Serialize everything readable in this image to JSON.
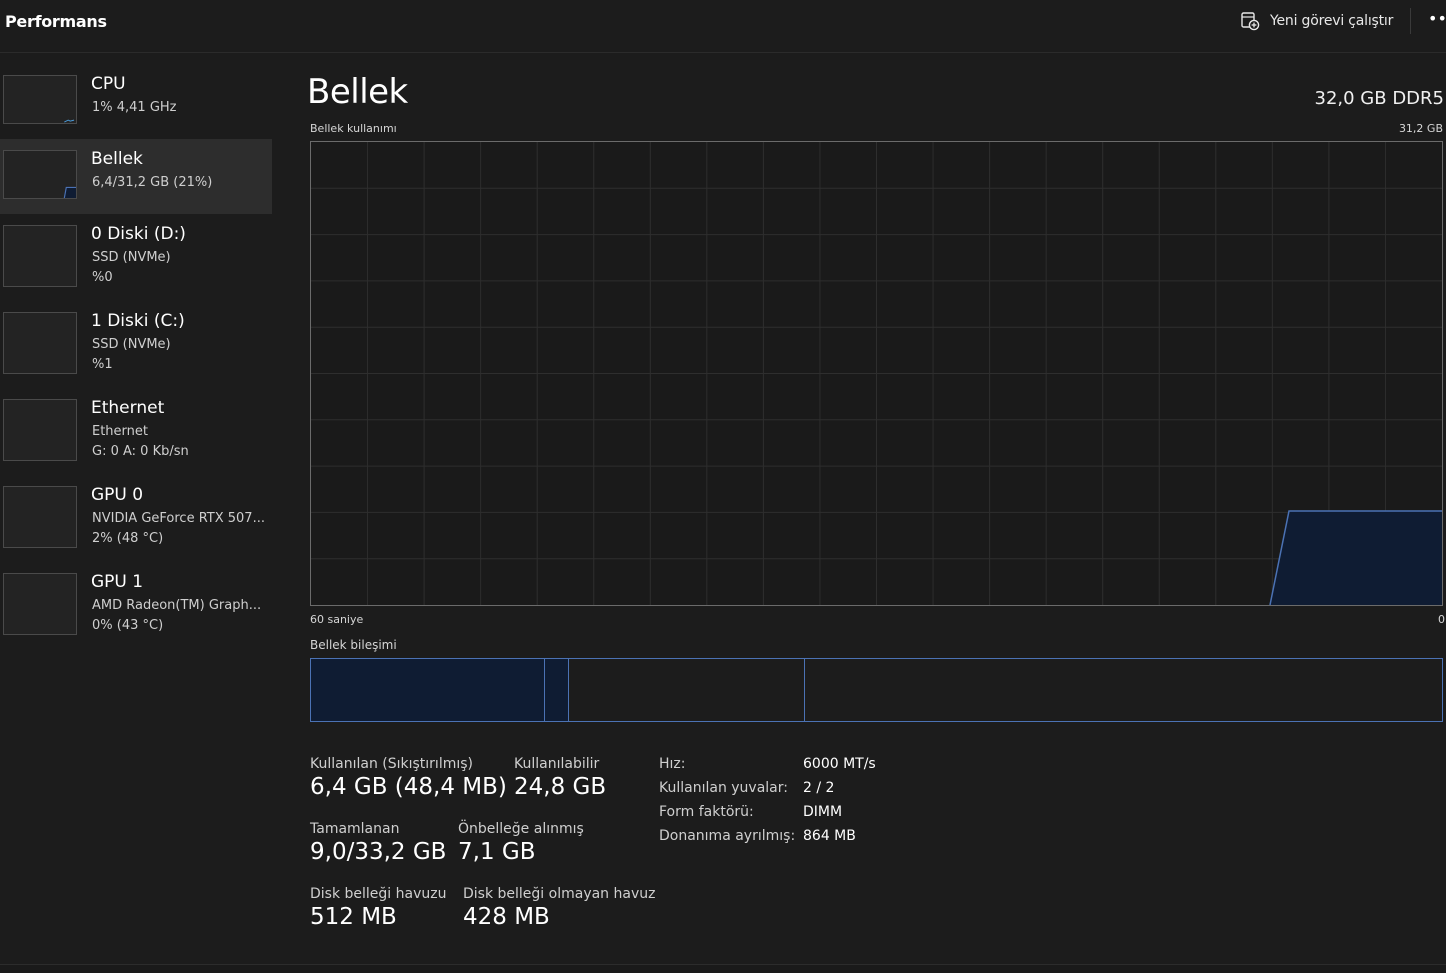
{
  "header": {
    "title": "Performans",
    "new_task_label": "Yeni görevi çalıştır",
    "more_glyph": "•••"
  },
  "sidebar": {
    "items": [
      {
        "title": "CPU",
        "line1": "1%  4,41 GHz",
        "line2": ""
      },
      {
        "title": "Bellek",
        "line1": "6,4/31,2 GB (21%)",
        "line2": ""
      },
      {
        "title": "0 Diski (D:)",
        "line1": "SSD (NVMe)",
        "line2": "%0"
      },
      {
        "title": "1 Diski (C:)",
        "line1": "SSD (NVMe)",
        "line2": "%1"
      },
      {
        "title": "Ethernet",
        "line1": "Ethernet",
        "line2": "G: 0  A: 0 Kb/sn"
      },
      {
        "title": "GPU 0",
        "line1": "NVIDIA GeForce RTX 507...",
        "line2": "2%  (48 °C)"
      },
      {
        "title": "GPU 1",
        "line1": "AMD Radeon(TM) Graph...",
        "line2": "0%  (43 °C)"
      }
    ],
    "selected_index": 1
  },
  "main": {
    "title": "Bellek",
    "memory_type": "32,0 GB DDR5",
    "usage_graph": {
      "label": "Bellek kullanımı",
      "max_label": "31,2 GB",
      "time_left_label": "60 saniye",
      "time_right_label": "0"
    },
    "composition": {
      "label": "Bellek bileşimi",
      "segments_fraction": [
        0.207,
        0.021,
        0.209,
        0.563
      ]
    },
    "stats": {
      "in_use_label": "Kullanılan (Sıkıştırılmış)",
      "in_use_value": "6,4 GB (48,4 MB)",
      "available_label": "Kullanılabilir",
      "available_value": "24,8 GB",
      "committed_label": "Tamamlanan",
      "committed_value": "9,0/33,2 GB",
      "cached_label": "Önbelleğe alınmış",
      "cached_value": "7,1 GB",
      "paged_pool_label": "Disk belleği havuzu",
      "paged_pool_value": "512 MB",
      "nonpaged_pool_label": "Disk belleği olmayan havuz",
      "nonpaged_pool_value": "428 MB"
    },
    "details": {
      "speed_label": "Hız:",
      "speed_value": "6000 MT/s",
      "slots_label": "Kullanılan yuvalar:",
      "slots_value": "2 / 2",
      "form_factor_label": "Form faktörü:",
      "form_factor_value": "DIMM",
      "reserved_label": "Donanıma ayrılmış:",
      "reserved_value": "864 MB"
    }
  },
  "colors": {
    "accent": "#4b72b4",
    "fill": "#0f1c33",
    "background": "#1c1c1c",
    "grid": "#2e2e2e"
  }
}
